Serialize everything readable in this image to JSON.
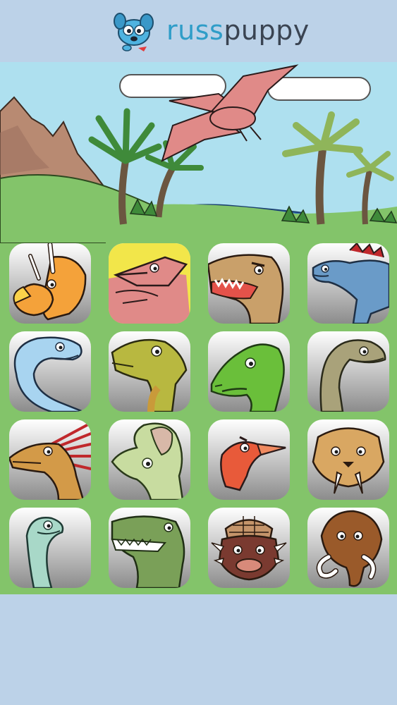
{
  "header": {
    "brand_part1": "russ",
    "brand_part2": "puppy",
    "logo_icon": "blue-puppy-mascot-icon"
  },
  "colors": {
    "background": "#bcd2e8",
    "grass": "#83c46a",
    "sky": "#aee0ef",
    "brand_blue": "#2f9dc8",
    "brand_dark": "#3a4452"
  },
  "scene": {
    "description_icon": "prehistoric-landscape-icon"
  },
  "tiles": [
    {
      "id": "triceratops",
      "icon": "triceratops-icon"
    },
    {
      "id": "pteranodon",
      "icon": "pteranodon-icon"
    },
    {
      "id": "t-rex",
      "icon": "t-rex-icon"
    },
    {
      "id": "stegosaurus",
      "icon": "stegosaurus-icon"
    },
    {
      "id": "plesiosaur",
      "icon": "plesiosaur-icon"
    },
    {
      "id": "iguanodon",
      "icon": "iguanodon-icon"
    },
    {
      "id": "green-raptor",
      "icon": "green-raptor-icon"
    },
    {
      "id": "brachiosaurus",
      "icon": "brachiosaurus-icon"
    },
    {
      "id": "spinosaurus",
      "icon": "spinosaurus-icon"
    },
    {
      "id": "parasaurolophus",
      "icon": "parasaurolophus-icon"
    },
    {
      "id": "archaeopteryx",
      "icon": "archaeopteryx-icon"
    },
    {
      "id": "sabertooth",
      "icon": "sabertooth-tiger-icon"
    },
    {
      "id": "diplodocus",
      "icon": "diplodocus-icon"
    },
    {
      "id": "crocodile",
      "icon": "crocodile-icon"
    },
    {
      "id": "ankylosaurus",
      "icon": "ankylosaurus-icon"
    },
    {
      "id": "mammoth",
      "icon": "mammoth-icon"
    }
  ]
}
